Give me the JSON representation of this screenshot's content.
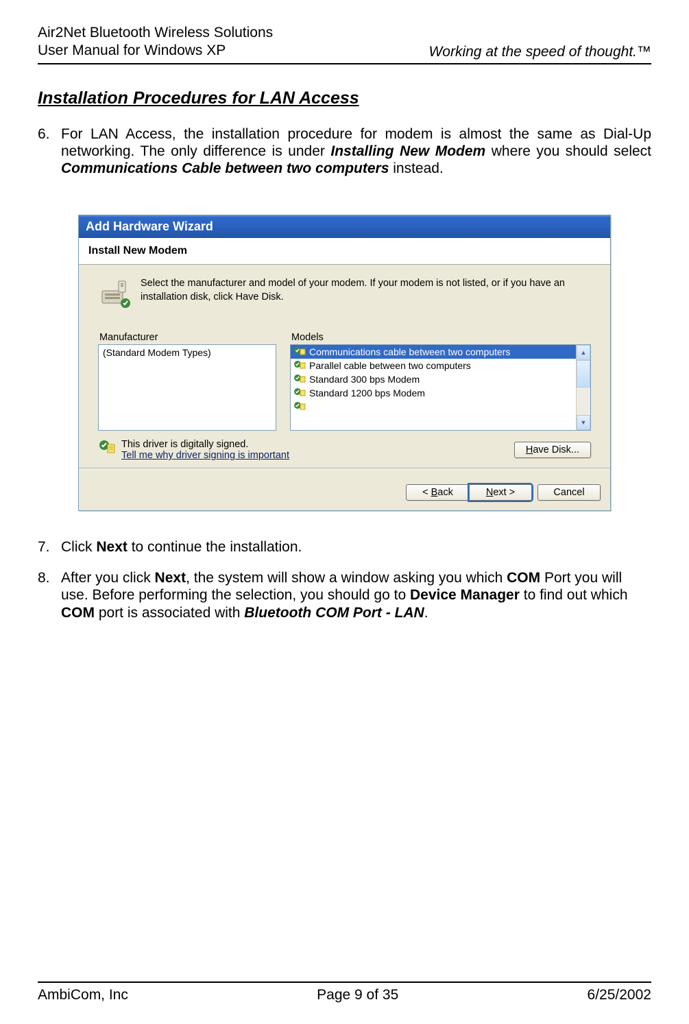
{
  "header": {
    "left_line1": "Air2Net Bluetooth Wireless Solutions",
    "left_line2": "User Manual for Windows XP",
    "right": "Working at the speed of thought.™"
  },
  "section_heading": "Installation Procedures for LAN Access",
  "paragraphs": {
    "p6_num": "6.",
    "p6_a": "For LAN Access, the installation procedure for modem is almost the same as Dial-Up networking. The only difference is under ",
    "p6_b": "Installing New Modem",
    "p6_c": " where you should select ",
    "p6_d": "Communications Cable between two computers",
    "p6_e": " instead.",
    "p7_num": "7.",
    "p7_a": "Click ",
    "p7_b": "Next",
    "p7_c": " to continue the installation.",
    "p8_num": "8.",
    "p8_a": "After you click ",
    "p8_b": "Next",
    "p8_c": ", the system will show a window asking you which ",
    "p8_d": "COM",
    "p8_e": " Port you will use. Before performing the selection, you should go to ",
    "p8_f": "Device Manager",
    "p8_g": " to find out which ",
    "p8_h": "COM",
    "p8_i": " port is associated with ",
    "p8_j": "Bluetooth COM Port - LAN",
    "p8_k": "."
  },
  "wizard": {
    "title": "Add Hardware Wizard",
    "banner": "Install New Modem",
    "intro": "Select the manufacturer and model of your modem. If your modem is not listed, or if you have an installation disk, click Have Disk.",
    "manu_label": "Manufacturer",
    "manu_items": [
      "(Standard Modem Types)"
    ],
    "models_label": "Models",
    "models_items": [
      "Communications cable between two computers",
      "Parallel cable between two computers",
      "Standard   300 bps Modem",
      "Standard  1200 bps Modem"
    ],
    "signed_text": "This driver is digitally signed.",
    "signed_link": "Tell me why driver signing is important",
    "have_disk_pre": "H",
    "have_disk_post": "ave Disk...",
    "back_pre": "< ",
    "back_u": "B",
    "back_post": "ack",
    "next_u": "N",
    "next_post": "ext >",
    "cancel": "Cancel"
  },
  "footer": {
    "left": "AmbiCom, Inc",
    "center": "Page 9 of 35",
    "right": "6/25/2002"
  },
  "chart_data": null
}
